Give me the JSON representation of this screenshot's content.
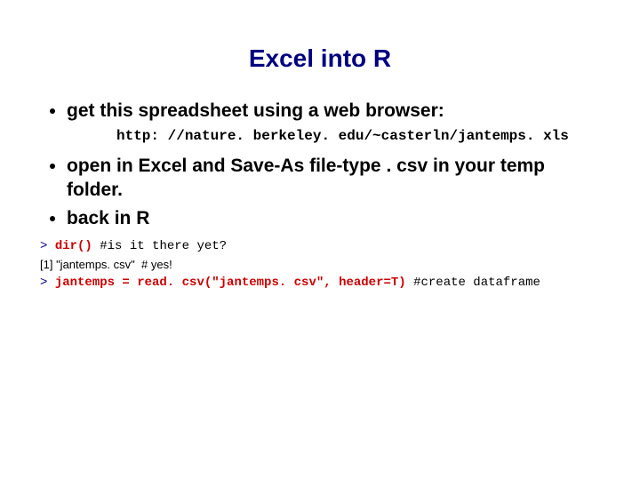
{
  "title": "Excel into R",
  "bullets": {
    "b1": "get this spreadsheet using a web browser:",
    "url": "http: //nature. berkeley. edu/~casterln/jantemps. xls",
    "b2": "open in Excel and Save-As file-type . csv in your temp folder.",
    "b3": " back in R"
  },
  "code": {
    "l1_prompt": "> ",
    "l1_cmd": "dir()",
    "l1_comment": " #is it there yet?",
    "l2_text": "[1] \"jantemps. csv\"  # yes!",
    "l3_prompt": "> ",
    "l3_cmd": "jantemps = read. csv(\"jantemps. csv\", header=T)",
    "l3_comment": " #create dataframe"
  }
}
